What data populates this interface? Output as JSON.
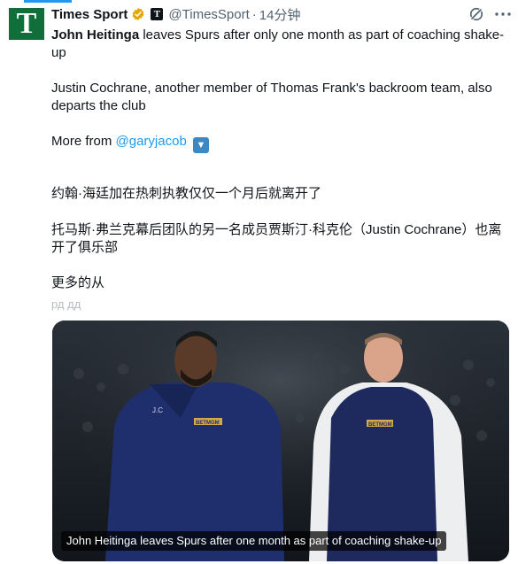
{
  "account": {
    "name": "Times Sport",
    "handle": "@TimesSport",
    "separator": "·",
    "time": "14分钟",
    "avatar_letter": "T",
    "brand_badge": "T",
    "avatar_color": "#0f6e3a",
    "verified_color": "#e6a800"
  },
  "tweet": {
    "line1_bold": "John Heitinga",
    "line1_rest": " leaves Spurs after only one month as part of coaching shake-up",
    "line2": "Justin Cochrane, another member of Thomas Frank's backroom team, also departs the club",
    "line3_prefix": "More from ",
    "line3_link": "@garyjacob",
    "line3_emoji_icon": "down-arrow-emoji"
  },
  "translation": {
    "line1": "约翰·海廷加在热刺执教仅仅一个月后就离开了",
    "line2": "托马斯·弗兰克幕后团队的另一名成员贾斯汀·科克伦（Justin Cochrane）也离开了俱乐部",
    "line3": "更多的从",
    "line4": "рд дд"
  },
  "media": {
    "caption": "John Heitinga leaves Spurs after one month as part of coaching shake-up",
    "jacket_left_label": "J.C",
    "sponsor": "BETMGM"
  },
  "icons": {
    "verified": "verified-badge-icon",
    "grok": "grok-icon",
    "more": "more-options-icon"
  },
  "colors": {
    "link": "#1d9bf0",
    "text": "#0f1419",
    "secondary": "#536471"
  }
}
